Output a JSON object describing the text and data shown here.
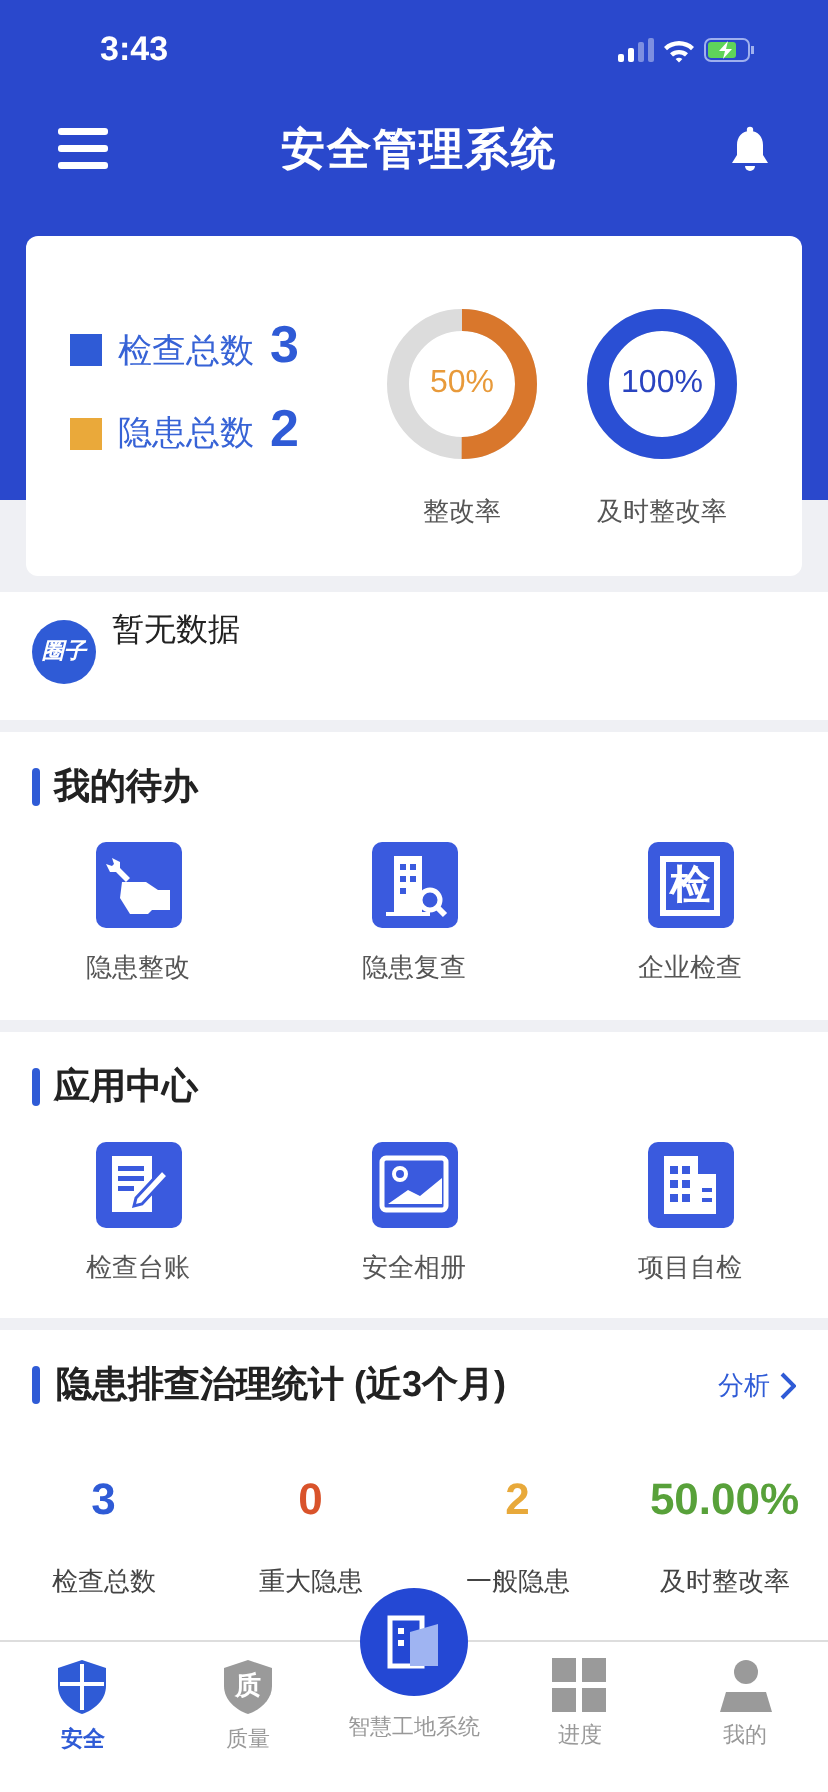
{
  "status_bar": {
    "time": "3:43"
  },
  "header": {
    "title": "安全管理系统"
  },
  "summary": {
    "legend": [
      {
        "label": "检查总数",
        "value": "3",
        "color": "#2f5bd6"
      },
      {
        "label": "隐患总数",
        "value": "2",
        "color": "#eaa93a"
      }
    ],
    "gauges": [
      {
        "reading": "50%",
        "label": "整改率",
        "color": "#d9772c"
      },
      {
        "reading": "100%",
        "label": "及时整改率",
        "color": "#2a4fd4"
      }
    ]
  },
  "circle": {
    "badge": "圈子",
    "text": "暂无数据"
  },
  "sections": [
    {
      "title": "我的待办",
      "items": [
        {
          "label": "隐患整改"
        },
        {
          "label": "隐患复查"
        },
        {
          "label": "企业检查",
          "icon_text": "检"
        }
      ]
    },
    {
      "title": "应用中心",
      "items": [
        {
          "label": "检查台账"
        },
        {
          "label": "安全相册"
        },
        {
          "label": "项目自检"
        }
      ]
    }
  ],
  "stats": {
    "title": "隐患排查治理统计 (近3个月)",
    "link": "分析",
    "items": [
      {
        "value": "3",
        "label": "检查总数",
        "color": "#2f5bd6"
      },
      {
        "value": "0",
        "label": "重大隐患",
        "color": "#d9532b"
      },
      {
        "value": "2",
        "label": "一般隐患",
        "color": "#e8a93a"
      },
      {
        "value": "50.00%",
        "label": "及时整改率",
        "color": "#58a13a"
      }
    ]
  },
  "tab_bar": [
    {
      "label": "安全",
      "kind": "tab",
      "selected": true
    },
    {
      "label": "质量",
      "kind": "tab",
      "icon_text": "质",
      "selected": false
    },
    {
      "label": "智慧工地系统",
      "kind": "center",
      "selected": false
    },
    {
      "label": "进度",
      "kind": "tab",
      "selected": false
    },
    {
      "label": "我的",
      "kind": "tab",
      "selected": false
    }
  ]
}
